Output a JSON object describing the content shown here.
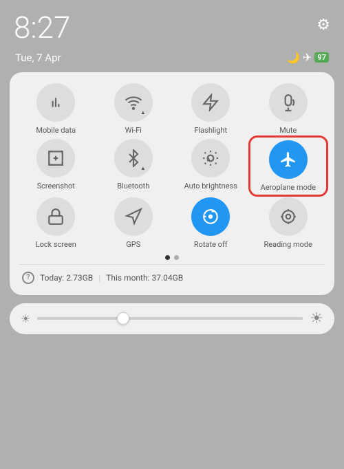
{
  "statusBar": {
    "time": "8:27",
    "date": "Tue, 7 Apr",
    "battery": "97",
    "gearLabel": "⚙"
  },
  "tiles": [
    {
      "id": "mobile-data",
      "label": "Mobile data",
      "icon": "mobile-data",
      "active": false
    },
    {
      "id": "wifi",
      "label": "Wi-Fi",
      "icon": "wifi",
      "active": false
    },
    {
      "id": "flashlight",
      "label": "Flashlight",
      "icon": "flashlight",
      "active": false
    },
    {
      "id": "mute",
      "label": "Mute",
      "icon": "mute",
      "active": false
    },
    {
      "id": "screenshot",
      "label": "Screenshot",
      "icon": "screenshot",
      "active": false
    },
    {
      "id": "bluetooth",
      "label": "Bluetooth",
      "icon": "bluetooth",
      "active": false
    },
    {
      "id": "auto-brightness",
      "label": "Auto brightness",
      "icon": "auto-brightness",
      "active": false
    },
    {
      "id": "aeroplane-mode",
      "label": "Aeroplane mode",
      "icon": "aeroplane",
      "active": true,
      "highlighted": true
    },
    {
      "id": "lock-screen",
      "label": "Lock screen",
      "icon": "lock",
      "active": false
    },
    {
      "id": "gps",
      "label": "GPS",
      "icon": "gps",
      "active": false
    },
    {
      "id": "rotate-off",
      "label": "Rotate off",
      "icon": "rotate",
      "active": true
    },
    {
      "id": "reading-mode",
      "label": "Reading mode",
      "icon": "reading",
      "active": false
    }
  ],
  "dataUsage": {
    "today": "Today: 2.73GB",
    "month": "This month: 37.04GB"
  },
  "dots": [
    true,
    false
  ],
  "brightness": {
    "leftIcon": "☀",
    "rightIcon": "☀"
  }
}
